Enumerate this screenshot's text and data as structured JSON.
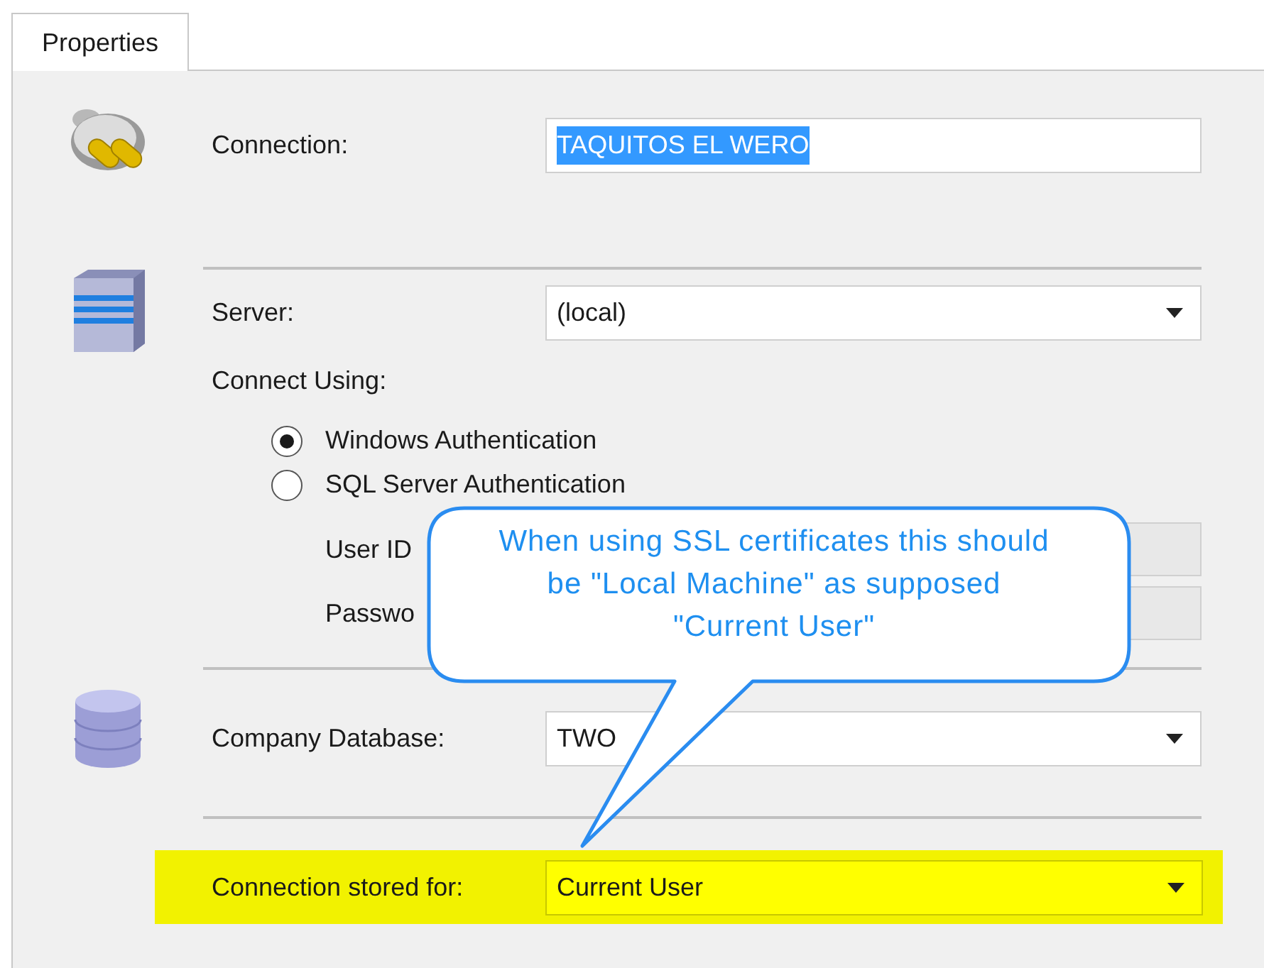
{
  "tab": {
    "label": "Properties",
    "selected": true
  },
  "connection": {
    "label": "Connection:",
    "value": "TAQUITOS EL WERO",
    "value_selected": true
  },
  "server": {
    "label": "Server:",
    "value": "(local)"
  },
  "connect_using": {
    "label": "Connect Using:",
    "options": [
      {
        "label": "Windows Authentication",
        "selected": true
      },
      {
        "label": "SQL Server Authentication",
        "selected": false
      }
    ]
  },
  "credentials": [
    {
      "label": "User ID",
      "disabled": true
    },
    {
      "label": "Passwo",
      "disabled": true
    }
  ],
  "company_database": {
    "label": "Company Database:",
    "value": "TWO"
  },
  "connection_stored_for": {
    "label": "Connection stored for:",
    "value": "Current User",
    "highlighted": true
  },
  "callout": {
    "lines": [
      "When using SSL certificates this should",
      "be \"Local Machine\" as supposed",
      "\"Current User\""
    ]
  }
}
